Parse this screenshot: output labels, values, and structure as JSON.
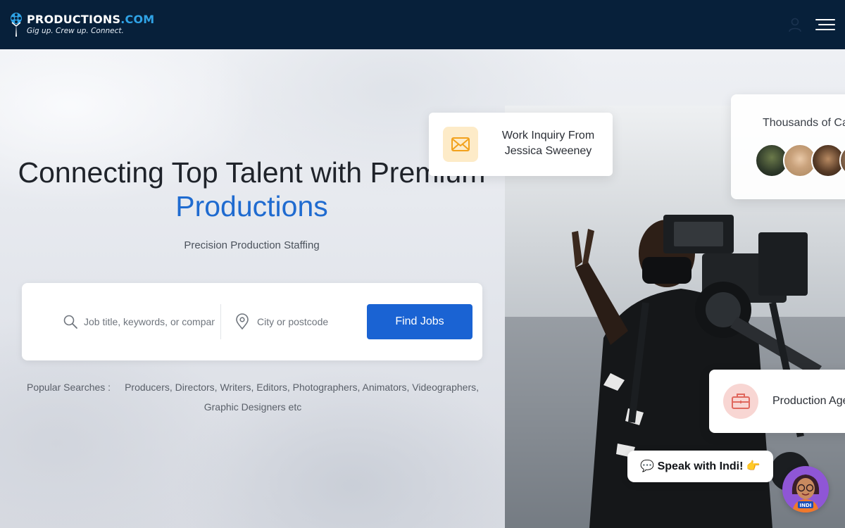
{
  "brand": {
    "name_part1": "PRODUCTIONS",
    "name_part2": ".COM",
    "tagline": "Gig up. Crew up. Connect.",
    "accent_color": "#2fa3e6",
    "header_bg": "#07203a"
  },
  "header": {
    "user_icon": "user-icon",
    "menu_icon": "hamburger-menu-icon"
  },
  "hero": {
    "title_line1": "Connecting Top Talent with Premium",
    "title_line2": "Productions",
    "title_accent_color": "#1f6bd0",
    "subtitle": "Precision Production Staffing"
  },
  "search": {
    "job_placeholder": "Job title, keywords, or company",
    "job_value": "",
    "city_placeholder": "City or postcode",
    "city_value": "",
    "button_label": "Find Jobs",
    "button_color": "#1a63d3"
  },
  "popular": {
    "label": "Popular Searches :",
    "items": "Producers, Directors, Writers, Editors, Photographers, Animators, Videographers, Graphic Designers etc"
  },
  "cards": {
    "inquiry": {
      "text_line1": "Work Inquiry From",
      "text_line2": "Jessica Sweeney",
      "icon": "envelope-icon"
    },
    "thousands": {
      "text": "Thousands of Ca"
    },
    "agency": {
      "text": "Production Age",
      "icon": "briefcase-icon"
    }
  },
  "chat": {
    "bubble_text": "💬 Speak with Indi! 👉",
    "avatar_label": "INDI"
  }
}
